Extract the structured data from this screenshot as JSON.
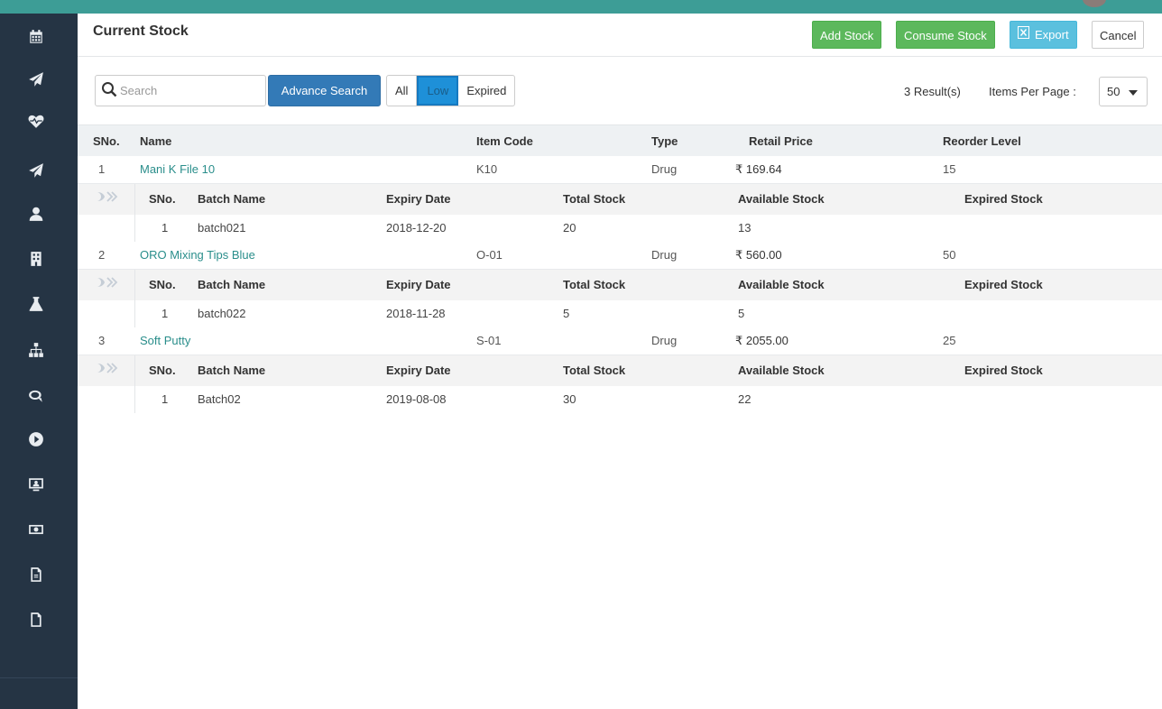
{
  "header": {
    "title": "Current Stock",
    "add_stock": "Add Stock",
    "consume_stock": "Consume Stock",
    "export": "Export",
    "cancel": "Cancel"
  },
  "toolbar": {
    "search_placeholder": "Search",
    "advance_search": "Advance Search",
    "filters": [
      "All",
      "Low",
      "Expired"
    ],
    "active_filter": "Low",
    "results": "3 Result(s)",
    "items_per_page_label": "Items Per Page :",
    "items_per_page_value": "50"
  },
  "columns": {
    "sno": "SNo.",
    "name": "Name",
    "item_code": "Item Code",
    "type": "Type",
    "retail_price": "Retail Price",
    "reorder_level": "Reorder Level"
  },
  "batch_columns": {
    "sno": "SNo.",
    "batch_name": "Batch Name",
    "expiry_date": "Expiry Date",
    "total_stock": "Total Stock",
    "available_stock": "Available Stock",
    "expired_stock": "Expired Stock"
  },
  "items": [
    {
      "sno": "1",
      "name": "Mani K File 10",
      "item_code": "K10",
      "type": "Drug",
      "retail_price": "₹ 169.64",
      "reorder_level": "15",
      "batch": {
        "sno": "1",
        "batch_name": "batch021",
        "expiry_date": "2018-12-20",
        "total_stock": "20",
        "available_stock": "13",
        "expired_stock": ""
      }
    },
    {
      "sno": "2",
      "name": "ORO Mixing Tips Blue",
      "item_code": "O-01",
      "type": "Drug",
      "retail_price": "₹ 560.00",
      "reorder_level": "50",
      "batch": {
        "sno": "1",
        "batch_name": "batch022",
        "expiry_date": "2018-11-28",
        "total_stock": "5",
        "available_stock": "5",
        "expired_stock": ""
      }
    },
    {
      "sno": "3",
      "name": "Soft Putty",
      "item_code": "S-01",
      "type": "Drug",
      "retail_price": "₹ 2055.00",
      "reorder_level": "25",
      "batch": {
        "sno": "1",
        "batch_name": "Batch02",
        "expiry_date": "2019-08-08",
        "total_stock": "30",
        "available_stock": "22",
        "expired_stock": ""
      }
    }
  ],
  "sidebar": {
    "icons": [
      "calendar-icon",
      "paper-plane-icon",
      "heartbeat-icon",
      "paper-plane-icon",
      "user-icon",
      "building-icon",
      "flask-icon",
      "sitemap-icon",
      "comments-icon",
      "play-circle-icon",
      "monitor-user-icon",
      "money-icon",
      "document-icon",
      "file-icon"
    ]
  },
  "colors": {
    "sidebar": "#253444",
    "topbar": "#3d9d96",
    "green_button": "#5cb85c",
    "export_button": "#5bc0de",
    "advance_search": "#337ab7",
    "low_filter": "#1e90d8",
    "item_link": "#2a8e8b"
  }
}
